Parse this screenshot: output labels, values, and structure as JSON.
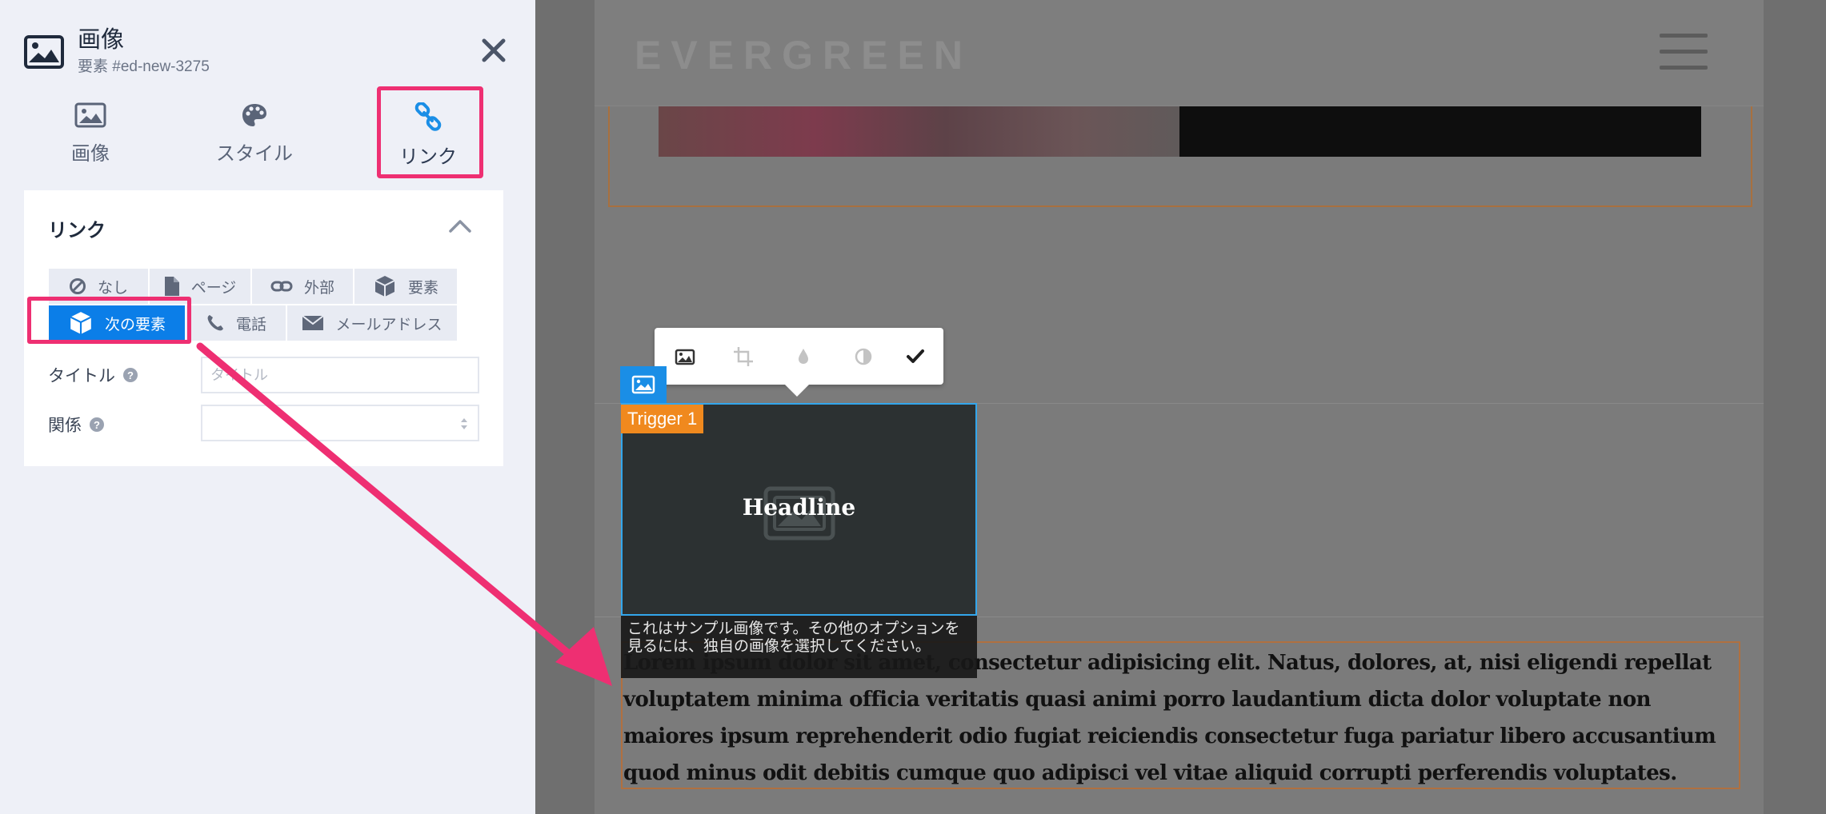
{
  "panel": {
    "title": "画像",
    "subtitle": "要素 #ed-new-3275",
    "tabs": [
      {
        "label": "画像",
        "icon": "image-icon"
      },
      {
        "label": "スタイル",
        "icon": "palette-icon"
      },
      {
        "label": "リンク",
        "icon": "link-icon",
        "active": true
      }
    ]
  },
  "link_card": {
    "title": "リンク",
    "types": [
      {
        "label": "なし",
        "icon": "ban-icon"
      },
      {
        "label": "ページ",
        "icon": "file-icon"
      },
      {
        "label": "外部",
        "icon": "link-icon"
      },
      {
        "label": "要素",
        "icon": "cube-icon"
      },
      {
        "label": "次の要素",
        "icon": "cube-icon",
        "active": true
      },
      {
        "label": "電話",
        "icon": "phone-icon"
      },
      {
        "label": "メールアドレス",
        "icon": "envelope-icon"
      }
    ],
    "title_label": "タイトル",
    "title_placeholder": "タイトル",
    "title_value": "",
    "rel_label": "関係",
    "rel_value": ""
  },
  "preview": {
    "logo": "EVERGREEN",
    "trigger_label": "Trigger 1",
    "headline": "Headline",
    "caption": "これはサンプル画像です。その他のオプションを見るには、独自の画像を選択してください。",
    "body_text": "Lorem ipsum dolor sit amet, consectetur adipisicing elit. Natus, dolores, at, nisi eligendi repellat voluptatem minima officia veritatis quasi animi porro laudantium dicta dolor voluptate non maiores ipsum reprehenderit odio fugiat reiciendis consectetur fuga pariatur libero accusantium quod minus odit debitis cumque quo adipisci vel vitae aliquid corrupti perferendis voluptates."
  },
  "colors": {
    "accent_blue": "#0b7ee8",
    "highlight_pink": "#ee2f72",
    "trigger_orange": "#f0891e",
    "selection_blue": "#33a6ec"
  }
}
